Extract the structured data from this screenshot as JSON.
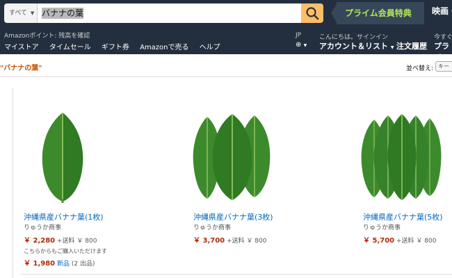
{
  "header": {
    "category": "すべて",
    "search_value": "バナナの葉",
    "prime_banner": "プライム会員特典",
    "movie": "映画・"
  },
  "subnav": {
    "points": "Amazonポイント: 残高を確認",
    "links": [
      "マイストア",
      "タイムセール",
      "ギフト券",
      "Amazonで売る",
      "ヘルプ"
    ],
    "lang": "JP",
    "hello": "こんにちは。サインイン",
    "account": "アカウント＆リスト",
    "orders": "注文履歴",
    "now": "今すぐ",
    "prime": "プライ"
  },
  "results": {
    "query": "\"バナナの葉\"",
    "sort_label": "並べ替え:",
    "sort_value": "キー"
  },
  "products": [
    {
      "title": "沖縄県産バナナ葉(1枚)",
      "brand": "りゅうか商事",
      "price": "￥ 2,280",
      "shipping": "+送料 ￥ 800",
      "leaves": 1
    },
    {
      "title": "沖縄県産バナナ葉(3枚)",
      "brand": "りゅうか商事",
      "price": "￥ 3,700",
      "shipping": "+送料 ￥ 800",
      "leaves": 3
    },
    {
      "title": "沖縄県産バナナ葉(5枚)",
      "brand": "りゅうか商事",
      "price": "￥ 5,700",
      "shipping": "+送料 ￥ 800",
      "leaves": 5
    }
  ],
  "other_offers": {
    "label": "こちらからもご購入いただけます",
    "price": "￥ 1,980",
    "new": "新品",
    "count": "(2 出品)"
  },
  "colors": {
    "header_bg": "#232f3e",
    "search_button": "#febd69",
    "prime_green": "#b5e55a",
    "price_red": "#b12704",
    "link_blue": "#0066c0",
    "leaf_green": "#3f8f2e"
  }
}
